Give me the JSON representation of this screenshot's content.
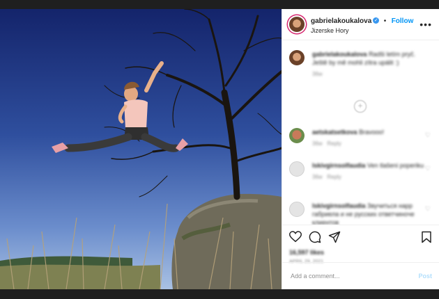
{
  "post": {
    "username": "gabrielakoukalova",
    "verified_mark": "✓",
    "separator": "•",
    "follow_label": "Follow",
    "location": "Jizerske Hory",
    "more_icon": "more-options-icon"
  },
  "caption": {
    "username": "gabrielakoukalova",
    "text": "Radši letím pryč. Ještě by mě mohli zítra upálit :)",
    "time": "36w"
  },
  "comments": [
    {
      "username": "aetskatsetkova",
      "text": "Bravooo!",
      "time": "36w",
      "reply": "Reply"
    },
    {
      "username": "lskivgirnsolfaudia",
      "text": "Ven tlašeni poperiku",
      "time": "36w",
      "reply": "Reply"
    },
    {
      "username": "lskivgirnsolfaudia",
      "text": "Звучиться нарр габриела и не русских ответчиноче клиентов",
      "time": "",
      "reply": ""
    }
  ],
  "stats": {
    "likes": "16,597 likes",
    "date": "APRIL 29, 2021"
  },
  "add_comment": {
    "placeholder": "Add a comment...",
    "post_label": "Post"
  },
  "icons": [
    "heart-icon",
    "comment-icon",
    "share-icon",
    "bookmark-icon",
    "verified-icon",
    "load-more-icon"
  ],
  "colors": {
    "link": "#0095f6",
    "post_disabled": "#b2dffc",
    "text": "#262626",
    "muted": "#8e8e8e"
  }
}
